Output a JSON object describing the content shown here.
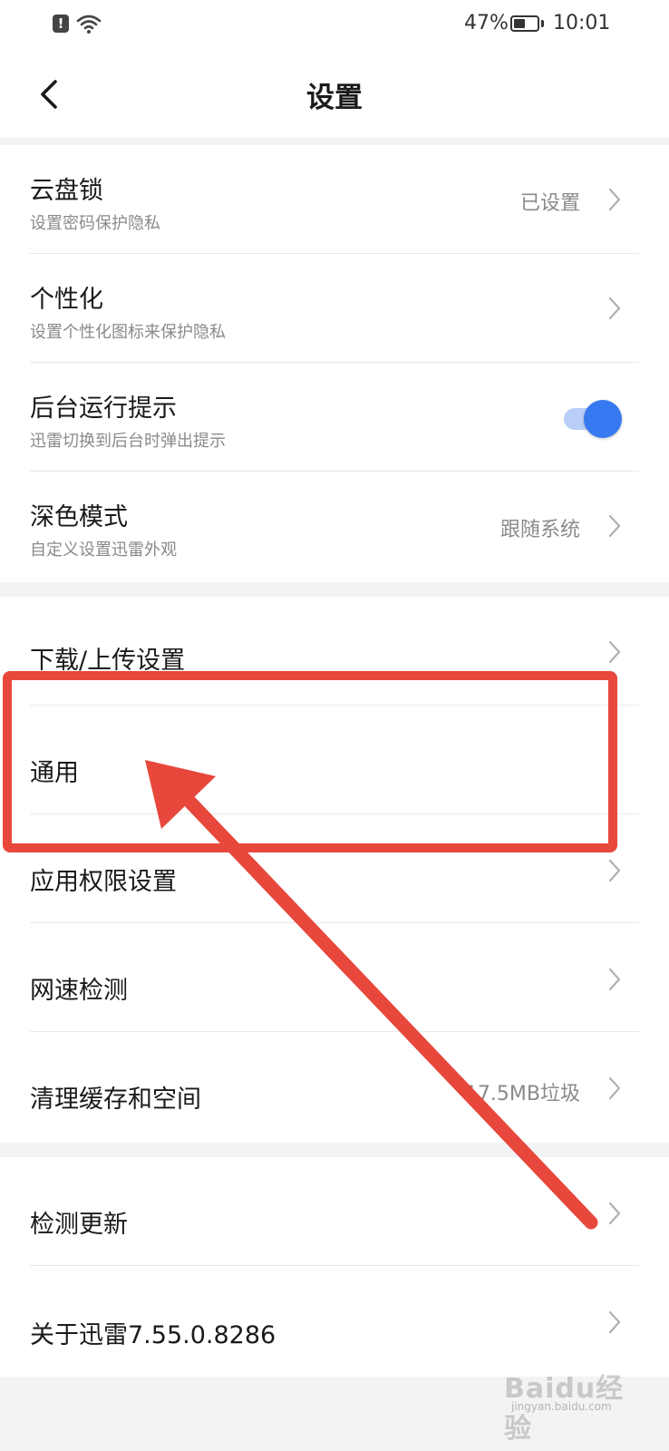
{
  "status_bar": {
    "battery_percent": "47%",
    "time": "10:01"
  },
  "header": {
    "title": "设置"
  },
  "section1": {
    "items": [
      {
        "title": "云盘锁",
        "subtitle": "设置密码保护隐私",
        "value": "已设置"
      },
      {
        "title": "个性化",
        "subtitle": "设置个性化图标来保护隐私"
      },
      {
        "title": "后台运行提示",
        "subtitle": "迅雷切换到后台时弹出提示",
        "toggle_on": true
      },
      {
        "title": "深色模式",
        "subtitle": "自定义设置迅雷外观",
        "value": "跟随系统"
      }
    ]
  },
  "section2": {
    "items": [
      {
        "title": "下载/上传设置"
      },
      {
        "title": "通用"
      },
      {
        "title": "应用权限设置"
      },
      {
        "title": "网速检测"
      },
      {
        "title": "清理缓存和空间",
        "value": "17.5MB垃圾"
      }
    ]
  },
  "section3": {
    "items": [
      {
        "title": "检测更新"
      },
      {
        "title": "关于迅雷7.55.0.8286"
      }
    ]
  },
  "watermark": {
    "text": "Baidu经验",
    "url": "jingyan.baidu.com"
  },
  "colors": {
    "accent": "#3779f0",
    "annotation": "#e8473c",
    "gap": "#f2f3f5"
  }
}
